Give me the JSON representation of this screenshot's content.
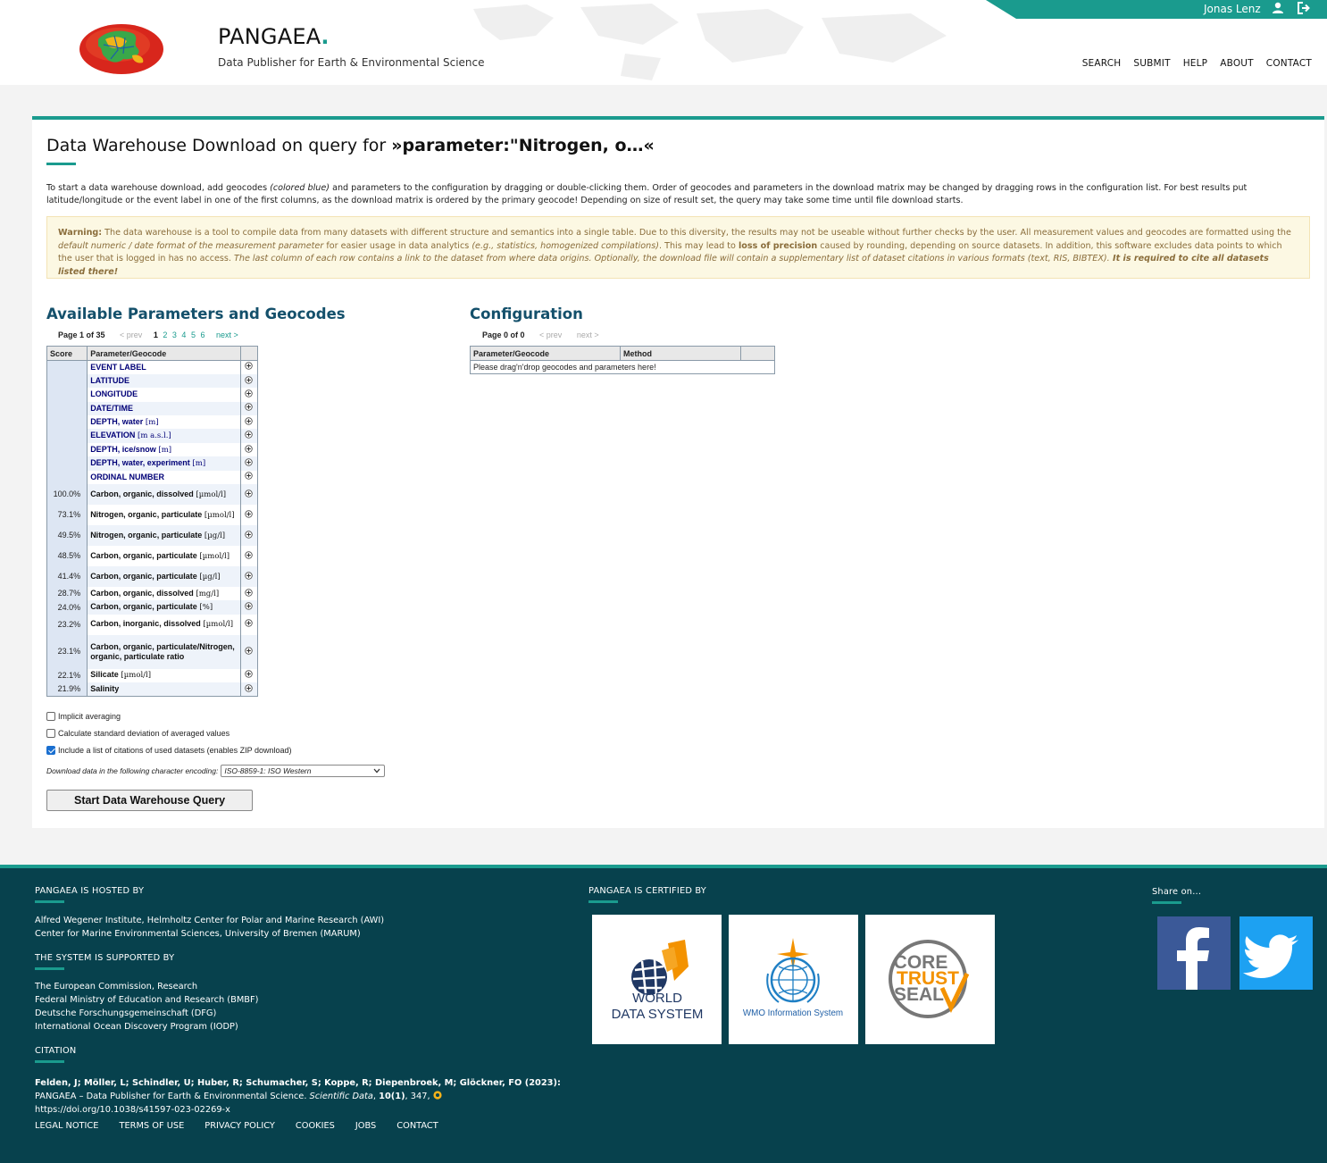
{
  "header": {
    "brand_name": "PANGAEA",
    "brand_dot": ".",
    "tagline": "Data Publisher for Earth & Environmental Science",
    "username": "Jonas Lenz",
    "nav": [
      "SEARCH",
      "SUBMIT",
      "HELP",
      "ABOUT",
      "CONTACT"
    ]
  },
  "page": {
    "title_prefix": "Data Warehouse Download on query for ",
    "title_query": "»parameter:\"Nitrogen, o…«",
    "intro_1": "To start a data warehouse download, add geocodes ",
    "intro_em": "(colored blue)",
    "intro_2": " and parameters to the configuration by dragging or double-clicking them. Order of geocodes and parameters in the download matrix may be changed by dragging rows in the configuration list. For best results put latitude/longitude or the event label in one of the first columns, as the download matrix is ordered by the primary geocode! Depending on size of result set, the query may take some time until file download starts.",
    "warning": {
      "label": "Warning:",
      "t1": " The data warehouse is a tool to compile data from many datasets with different structure and semantics into a single table. Due to this diversity, the results may not be useable without further checks by the user. All measurement values and geocodes are formatted using the ",
      "em1": "default numeric / date format of the measurement parameter",
      "t2": " for easier usage in data analytics ",
      "em2": "(e.g., statistics, homogenized compilations)",
      "t3": ". This may lead to ",
      "b1": "loss of precision",
      "t4": " caused by rounding, depending on source datasets. In addition, this software excludes data points to which the user that is logged in has no access. ",
      "em3": "The last column of each row contains a link to the dataset from where data origins. Optionally, the download file will contain a supplementary list of dataset citations in various formats (text, RIS, BIBTEX).",
      "b2": " It is required to cite all datasets listed there!"
    }
  },
  "available": {
    "heading": "Available Parameters and Geocodes",
    "pager_label": "Page 1 of 35",
    "prev": "< prev",
    "current": "1",
    "pages": [
      "2",
      "3",
      "4",
      "5",
      "6"
    ],
    "next": "next >",
    "col_score": "Score",
    "col_param": "Parameter/Geocode",
    "rows": [
      {
        "score": "",
        "name": "EVENT LABEL",
        "unit": "",
        "geo": true
      },
      {
        "score": "",
        "name": "LATITUDE",
        "unit": "",
        "geo": true
      },
      {
        "score": "",
        "name": "LONGITUDE",
        "unit": "",
        "geo": true
      },
      {
        "score": "",
        "name": "DATE/TIME",
        "unit": "",
        "geo": true
      },
      {
        "score": "",
        "name": "DEPTH, water",
        "unit": " [m]",
        "geo": true
      },
      {
        "score": "",
        "name": "ELEVATION",
        "unit": " [m a.s.l.]",
        "geo": true
      },
      {
        "score": "",
        "name": "DEPTH, ice/snow",
        "unit": " [m]",
        "geo": true
      },
      {
        "score": "",
        "name": "DEPTH, water, experiment",
        "unit": " [m]",
        "geo": true
      },
      {
        "score": "",
        "name": "ORDINAL NUMBER",
        "unit": "",
        "geo": true
      },
      {
        "score": "100.0%",
        "name": "Carbon, organic, dissolved",
        "unit": " [µmol/l]",
        "geo": false
      },
      {
        "score": "73.1%",
        "name": "Nitrogen, organic, particulate",
        "unit": " [µmol/l]",
        "geo": false
      },
      {
        "score": "49.5%",
        "name": "Nitrogen, organic, particulate",
        "unit": " [µg/l]",
        "geo": false
      },
      {
        "score": "48.5%",
        "name": "Carbon, organic, particulate",
        "unit": " [µmol/l]",
        "geo": false
      },
      {
        "score": "41.4%",
        "name": "Carbon, organic, particulate",
        "unit": " [µg/l]",
        "geo": false
      },
      {
        "score": "28.7%",
        "name": "Carbon, organic, dissolved",
        "unit": " [mg/l]",
        "geo": false
      },
      {
        "score": "24.0%",
        "name": "Carbon, organic, particulate",
        "unit": " [%]",
        "geo": false
      },
      {
        "score": "23.2%",
        "name": "Carbon, inorganic, dissolved",
        "unit": " [µmol/l]",
        "geo": false
      },
      {
        "score": "23.1%",
        "name": "Carbon, organic, particulate/Nitrogen, organic, particulate ratio",
        "unit": "",
        "geo": false
      },
      {
        "score": "22.1%",
        "name": "Silicate",
        "unit": " [µmol/l]",
        "geo": false
      },
      {
        "score": "21.9%",
        "name": "Salinity",
        "unit": "",
        "geo": false
      }
    ]
  },
  "configuration": {
    "heading": "Configuration",
    "pager_label": "Page 0 of 0",
    "prev": "< prev",
    "next": "next >",
    "col_param": "Parameter/Geocode",
    "col_method": "Method",
    "empty_msg": "Please drag'n'drop geocodes and parameters here!"
  },
  "options": {
    "implicit_averaging": {
      "label": "Implicit averaging",
      "checked": false
    },
    "std_dev": {
      "label": "Calculate standard deviation of averaged values",
      "checked": false
    },
    "citations": {
      "label": "Include a list of citations of used datasets (enables ZIP download)",
      "checked": true
    },
    "encoding_label": "Download data in the following character encoding:",
    "encoding_value": "ISO-8859-1: ISO Western",
    "start_button": "Start Data Warehouse Query"
  },
  "footer": {
    "hosted_head": "PANGAEA IS HOSTED BY",
    "hosted": [
      "Alfred Wegener Institute, Helmholtz Center for Polar and Marine Research (AWI)",
      "Center for Marine Environmental Sciences, University of Bremen (MARUM)"
    ],
    "supported_head": "THE SYSTEM IS SUPPORTED BY",
    "supported": [
      "The European Commission, Research",
      "Federal Ministry of Education and Research (BMBF)",
      "Deutsche Forschungsgemeinschaft (DFG)",
      "International Ocean Discovery Program (IODP)"
    ],
    "citation_head": "CITATION",
    "citation_authors": "Felden, J; Möller, L; Schindler, U; Huber, R; Schumacher, S; Koppe, R; Diepenbroek, M; Glöckner, FO (2023):",
    "citation_title": " PANGAEA – Data Publisher for Earth & Environmental Science. ",
    "citation_journal": "Scientific Data",
    "citation_sep": ", ",
    "citation_vol": "10(1)",
    "citation_pages": ", 347, ",
    "citation_doi": "https://doi.org/10.1038/s41597-023-02269-x",
    "certified_head": "PANGAEA IS CERTIFIED BY",
    "certs": [
      {
        "line1": "WORLD",
        "line2": "DATA SYSTEM"
      },
      {
        "text": "WMO Information System"
      },
      {
        "line1": "CORE",
        "line2": "TRUST",
        "line3": "SEAL"
      }
    ],
    "share_head": "Share on...",
    "links": [
      "LEGAL NOTICE",
      "TERMS OF USE",
      "PRIVACY POLICY",
      "COOKIES",
      "JOBS",
      "CONTACT"
    ]
  },
  "colors": {
    "accent": "#1a9b8e",
    "footer_bg": "#07414d",
    "heading": "#14506b",
    "geocode": "#000077",
    "facebook": "#3b5998",
    "twitter": "#1da1f2"
  }
}
